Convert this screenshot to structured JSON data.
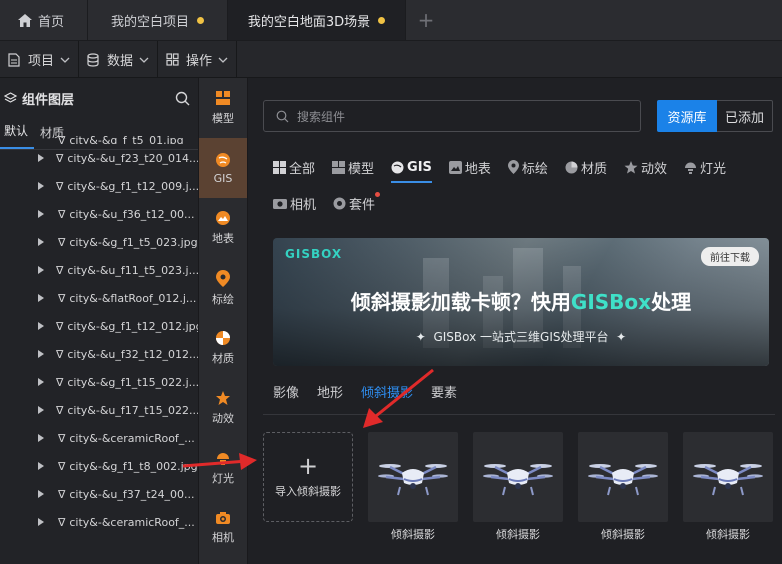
{
  "tabs": {
    "home": "首页",
    "project": "我的空白项目",
    "scene": "我的空白地面3D场景",
    "plus": "+"
  },
  "toolbar": {
    "project": "项目",
    "data": "数据",
    "operate": "操作"
  },
  "left_panel": {
    "title": "组件图层",
    "tabs": [
      "默认",
      "材质"
    ],
    "partial_top": "city&-&g_f_t5_01.jpg",
    "items": [
      "city&-&u_f23_t20_014...",
      "city&-&g_f1_t12_009.j...",
      "city&-&u_f36_t12_00...",
      "city&-&g_f1_t5_023.jpg",
      "city&-&u_f11_t5_023.j...",
      "city&-&flatRoof_012.j...",
      "city&-&g_f1_t12_012.jpg",
      "city&-&u_f32_t12_012....",
      "city&-&g_f1_t15_022.j...",
      "city&-&u_f17_t15_022....",
      "city&-&ceramicRoof_...",
      "city&-&g_f1_t8_002.jpg",
      "city&-&u_f37_t24_00...",
      "city&-&ceramicRoof_..."
    ]
  },
  "rail": [
    {
      "label": "模型",
      "icon": "model-icon"
    },
    {
      "label": "GIS",
      "icon": "gis-icon"
    },
    {
      "label": "地表",
      "icon": "terrain-icon"
    },
    {
      "label": "标绘",
      "icon": "pin-icon"
    },
    {
      "label": "材质",
      "icon": "material-icon"
    },
    {
      "label": "动效",
      "icon": "effect-icon"
    },
    {
      "label": "灯光",
      "icon": "light-icon"
    },
    {
      "label": "相机",
      "icon": "camera-icon"
    }
  ],
  "main": {
    "search_placeholder": "搜索组件",
    "btn_library": "资源库",
    "btn_added": "已添加",
    "categories_row1": [
      "全部",
      "模型",
      "GIS",
      "地表",
      "标绘",
      "材质",
      "动效",
      "灯光"
    ],
    "categories_row2": [
      "相机",
      "套件"
    ],
    "banner": {
      "logo": "GISBOX",
      "download": "前往下载",
      "headline_main": "倾斜摄影加载卡顿？快用",
      "headline_accent": "GISBox",
      "headline_tail": "处理",
      "sub": "GISBox 一站式三维GIS处理平台"
    },
    "subtabs": [
      "影像",
      "地形",
      "倾斜摄影",
      "要素"
    ],
    "import_label": "导入倾斜摄影",
    "card_labels": [
      "倾斜摄影",
      "倾斜摄影",
      "倾斜摄影",
      "倾斜摄影"
    ]
  },
  "colors": {
    "accent_blue": "#1b82e8",
    "accent_teal": "#3fe0c8",
    "arrow_red": "#e02a2a",
    "active_rail": "#5b4232",
    "rail_icon_orange": "#f08a24"
  }
}
